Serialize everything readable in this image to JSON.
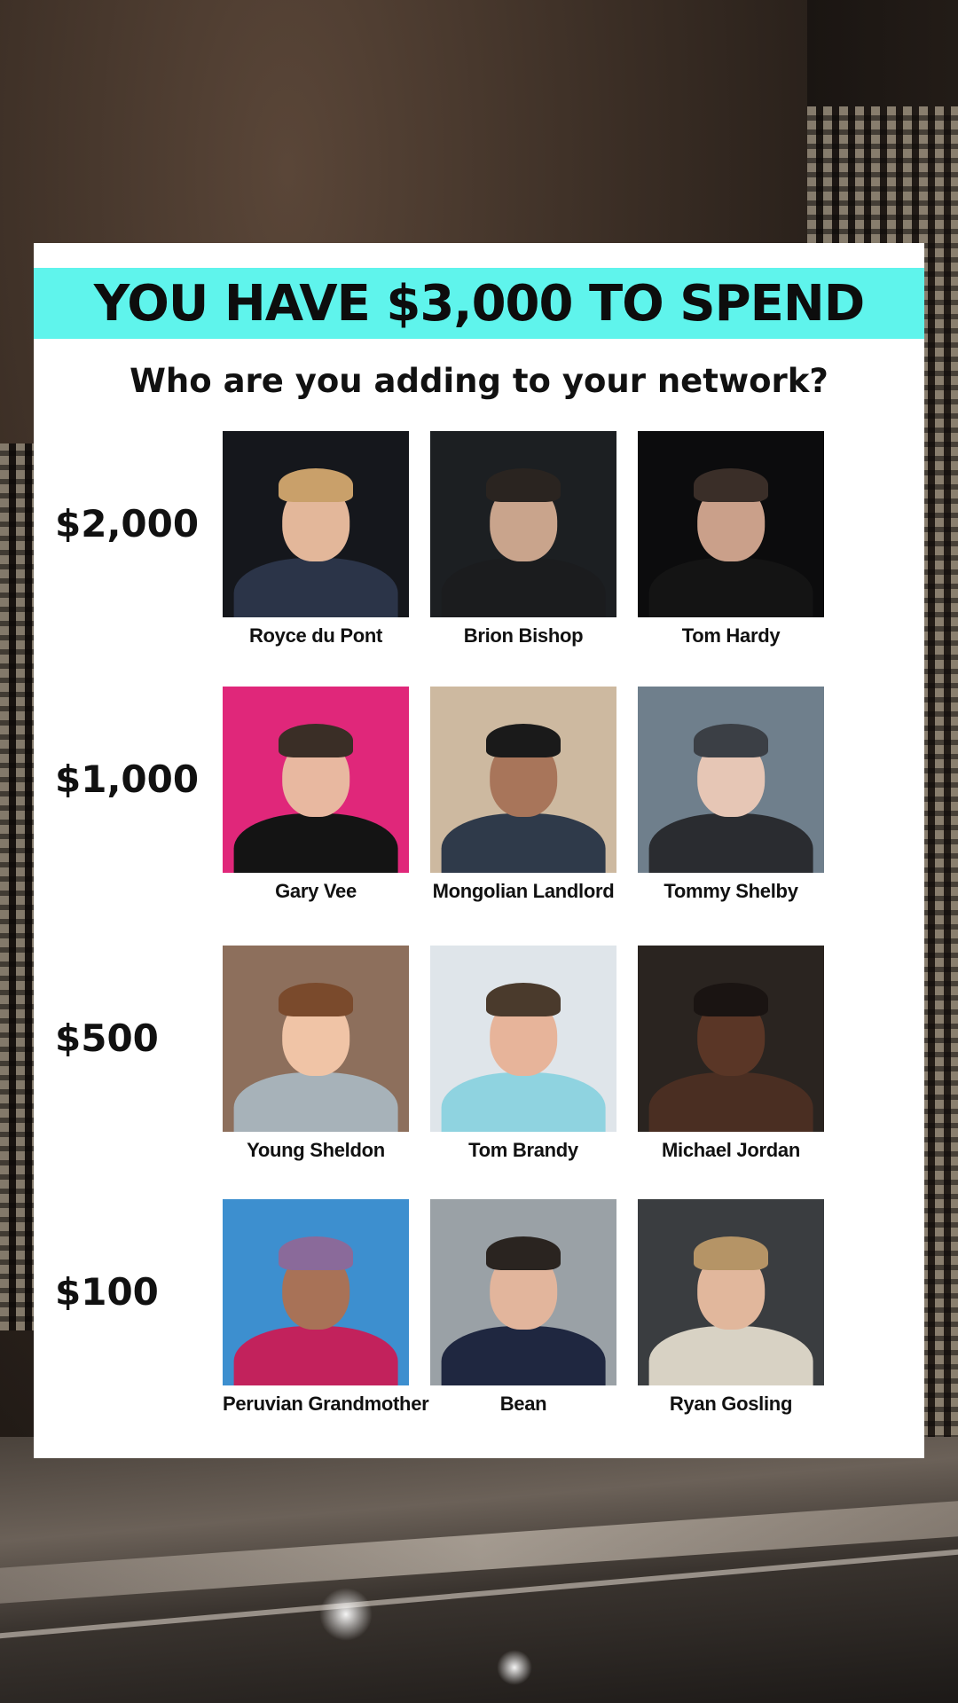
{
  "title": "YOU HAVE $3,000 TO SPEND",
  "subtitle": "Who are you adding to your network?",
  "colors": {
    "banner": "#5ff4ec",
    "card": "#ffffff",
    "text": "#111111"
  },
  "tiers": [
    {
      "price": "$2,000",
      "people": [
        {
          "name": "Royce du Pont",
          "bg": "#15171c",
          "skin": "#e3b79a",
          "hair": "#c9a06a",
          "top": "#2b3448"
        },
        {
          "name": "Brion Bishop",
          "bg": "#1c1f22",
          "skin": "#c9a48c",
          "hair": "#2a2420",
          "top": "#1b1c1e"
        },
        {
          "name": "Tom Hardy",
          "bg": "#0c0c0d",
          "skin": "#caa08a",
          "hair": "#3a2e28",
          "top": "#141414"
        }
      ]
    },
    {
      "price": "$1,000",
      "people": [
        {
          "name": "Gary Vee",
          "bg": "#e0277a",
          "skin": "#e8b8a0",
          "hair": "#3a2e26",
          "top": "#141414"
        },
        {
          "name": "Mongolian Landlord",
          "bg": "#cdb9a0",
          "skin": "#a8755a",
          "hair": "#1a1a1a",
          "top": "#2f3a4a"
        },
        {
          "name": "Tommy Shelby",
          "bg": "#6f7f8c",
          "skin": "#e6c6b5",
          "hair": "#3b3f45",
          "top": "#2a2c30"
        }
      ]
    },
    {
      "price": "$500",
      "people": [
        {
          "name": "Young Sheldon",
          "bg": "#8d6f5c",
          "skin": "#f0c4a6",
          "hair": "#7a4a2c",
          "top": "#a7b2b9"
        },
        {
          "name": "Tom Brandy",
          "bg": "#dfe5ea",
          "skin": "#e7b49a",
          "hair": "#4a3a2c",
          "top": "#8fd3e0"
        },
        {
          "name": "Michael Jordan",
          "bg": "#2a2420",
          "skin": "#5a3626",
          "hair": "#1a1412",
          "top": "#4a2e22"
        }
      ]
    },
    {
      "price": "$100",
      "people": [
        {
          "name": "Peruvian Grandmother",
          "bg": "#3d8fcf",
          "skin": "#a87257",
          "hair": "#8a6a9a",
          "top": "#c2225c"
        },
        {
          "name": "Bean",
          "bg": "#9aa1a6",
          "skin": "#e2b59c",
          "hair": "#2a2420",
          "top": "#1f2740"
        },
        {
          "name": "Ryan Gosling",
          "bg": "#3a3d40",
          "skin": "#e1b79c",
          "hair": "#b59466",
          "top": "#d8d2c4"
        }
      ]
    }
  ]
}
